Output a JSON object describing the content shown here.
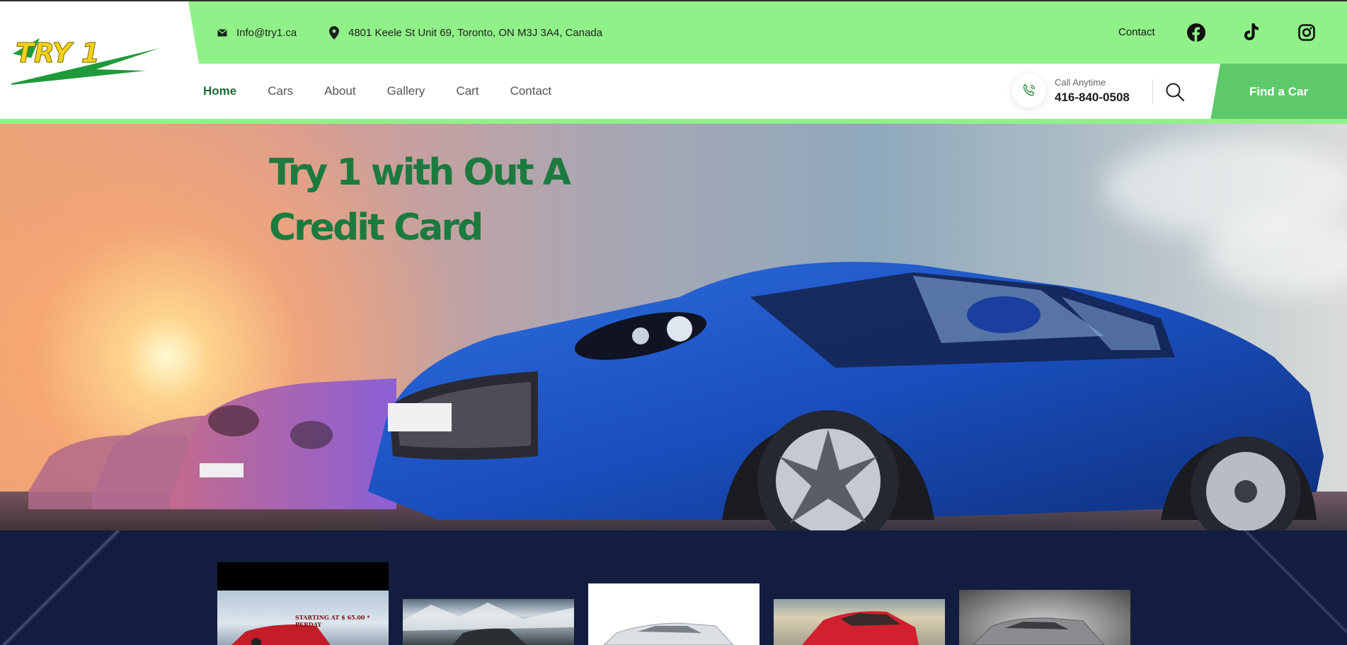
{
  "brand": {
    "logo_text": "TRY 1",
    "colors": {
      "topbar": "#90f188",
      "accent": "#5ec96a",
      "nav_active": "#1d6b3a",
      "hero_title": "#1c7a3f",
      "strip": "#131d3f"
    }
  },
  "topbar": {
    "email": "Info@try1.ca",
    "address": "4801 Keele St Unit 69, Toronto, ON M3J 3A4, Canada",
    "contact_label": "Contact",
    "social": [
      "facebook-icon",
      "tiktok-icon",
      "instagram-icon"
    ]
  },
  "nav": {
    "items": [
      {
        "label": "Home",
        "active": true
      },
      {
        "label": "Cars",
        "active": false
      },
      {
        "label": "About",
        "active": false
      },
      {
        "label": "Gallery",
        "active": false
      },
      {
        "label": "Cart",
        "active": false
      },
      {
        "label": "Contact",
        "active": false
      }
    ]
  },
  "call": {
    "label": "Call Anytime",
    "number": "416-840-0508"
  },
  "cta": {
    "find_car": "Find a Car"
  },
  "hero": {
    "title_line1": "Try 1 with Out A",
    "title_line2": "Credit Card"
  },
  "strip": {
    "promo_text": "STARTING AT $ 65.00 * PERDAY"
  }
}
